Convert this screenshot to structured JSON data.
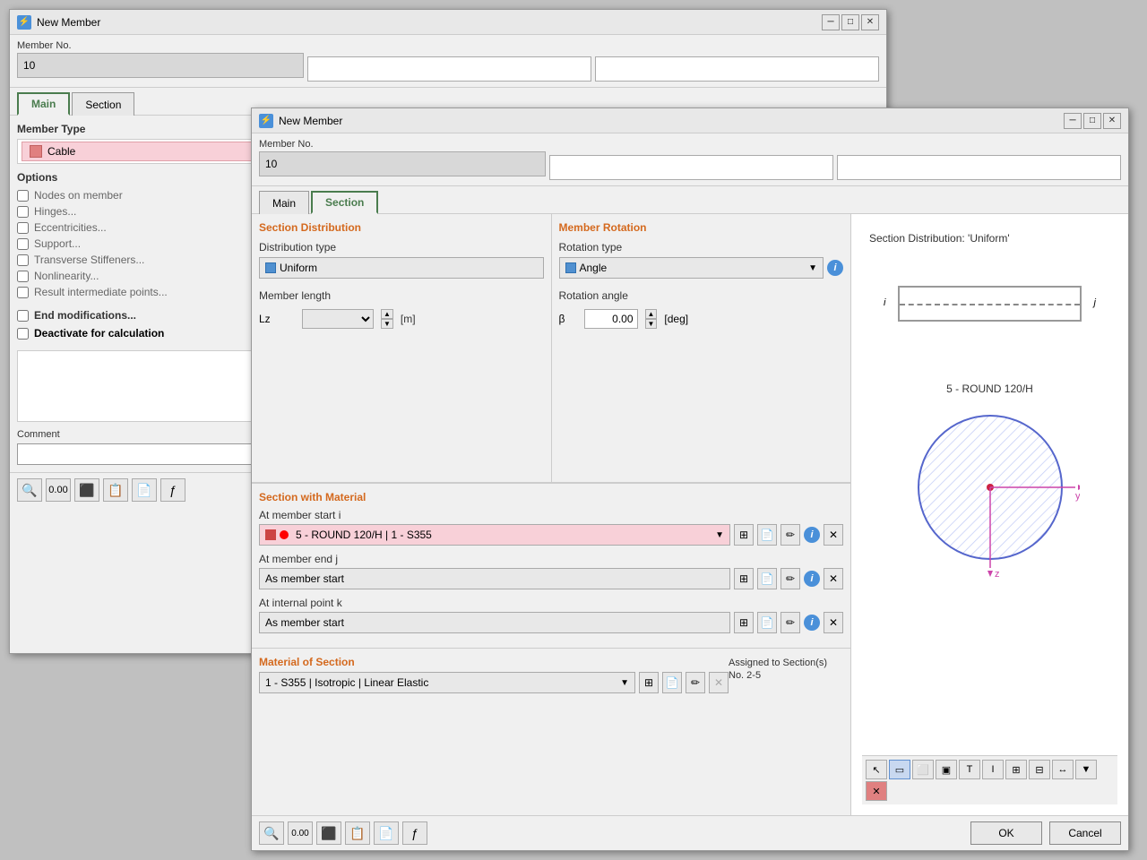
{
  "window1": {
    "title": "New Member",
    "member_no_label": "Member No.",
    "member_no_value": "10",
    "tab_main": "Main",
    "tab_section": "Section",
    "member_type_label": "Member Type",
    "cable_label": "Cable",
    "options_label": "Options",
    "checkboxes": [
      {
        "label": "Nodes on member",
        "checked": false
      },
      {
        "label": "Hinges...",
        "checked": false
      },
      {
        "label": "Eccentricities...",
        "checked": false
      },
      {
        "label": "Support...",
        "checked": false
      },
      {
        "label": "Transverse Stiffeners...",
        "checked": false
      },
      {
        "label": "Nonlinearity...",
        "checked": false
      },
      {
        "label": "Result intermediate points...",
        "checked": false
      }
    ],
    "end_modifications": "End modifications...",
    "deactivate": "Deactivate for calculation",
    "comment_label": "Comment"
  },
  "window2": {
    "title": "New Member",
    "member_no_label": "Member No.",
    "member_no_value": "10",
    "tab_main": "Main",
    "tab_section": "Section",
    "section_distribution_title": "Section Distribution",
    "distribution_type_label": "Distribution type",
    "distribution_type_value": "Uniform",
    "member_length_label": "Member length",
    "member_length_symbol": "Lz",
    "member_length_unit": "[m]",
    "member_rotation_title": "Member Rotation",
    "rotation_type_label": "Rotation type",
    "rotation_type_value": "Angle",
    "rotation_angle_label": "Rotation angle",
    "rotation_symbol": "β",
    "rotation_value": "0.00",
    "rotation_unit": "[deg]",
    "section_with_material_title": "Section with Material",
    "at_member_start_label": "At member start i",
    "start_section_value": "5 - ROUND 120/H | 1 - S355",
    "at_member_end_label": "At member end j",
    "end_section_value": "As member start",
    "at_internal_label": "At internal point k",
    "internal_section_value": "As member start",
    "material_of_section_title": "Material of Section",
    "assigned_to_sections": "Assigned to Section(s) No. 2-5",
    "material_value": "1 - S355 | Isotropic | Linear Elastic",
    "viz_title": "Section Distribution: 'Uniform'",
    "section_id_label": "5 - ROUND 120/H",
    "ok_label": "OK",
    "cancel_label": "Cancel",
    "toolbar_items": [
      "search",
      "value",
      "nodes",
      "copy",
      "paste",
      "function"
    ]
  }
}
